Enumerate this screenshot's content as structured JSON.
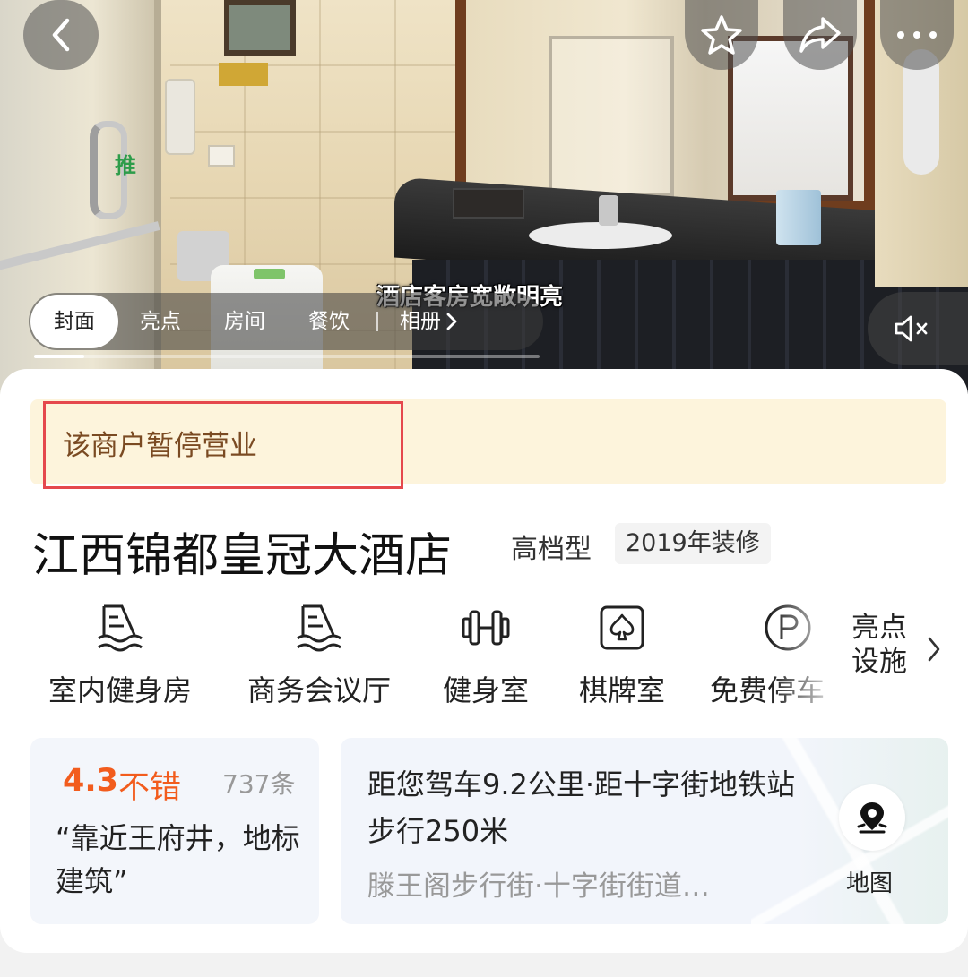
{
  "hero": {
    "caption": "酒店客房宽敞明亮",
    "tabs": [
      {
        "label": "封面",
        "active": true
      },
      {
        "label": "亮点",
        "active": false
      },
      {
        "label": "房间",
        "active": false
      },
      {
        "label": "餐饮",
        "active": false
      }
    ],
    "album_label": "相册",
    "progress": 0.1,
    "push_text": "推"
  },
  "toolbar": {
    "icons": [
      "back-icon",
      "star-icon",
      "share-icon",
      "more-icon",
      "mute-icon"
    ]
  },
  "notice": {
    "text": "该商户暂停营业"
  },
  "hotel": {
    "name": "江西锦都皇冠大酒店",
    "type": "高档型",
    "renovation": "2019年装修"
  },
  "facilities": {
    "items": [
      {
        "label": "室内健身房",
        "icon": "pool-icon"
      },
      {
        "label": "商务会议厅",
        "icon": "pool-icon"
      },
      {
        "label": "健身室",
        "icon": "dumbbell-icon"
      },
      {
        "label": "棋牌室",
        "icon": "spade-icon"
      },
      {
        "label": "免费停车",
        "icon": "parking-icon"
      }
    ],
    "more_label": "亮点设施"
  },
  "rating": {
    "score": "4.3",
    "word": "不错",
    "count": "737条",
    "quote": "“靠近王府井，地标建筑”"
  },
  "location": {
    "distance": "距您驾车9.2公里·距十字街地铁站步行250米",
    "area": "滕王阁步行街·十字街街道…",
    "map_label": "地图"
  },
  "colors": {
    "accent_orange": "#f25c1d",
    "notice_bg": "#fdf4dc",
    "notice_text": "#7a4a22",
    "highlight_border": "#e5484d"
  }
}
